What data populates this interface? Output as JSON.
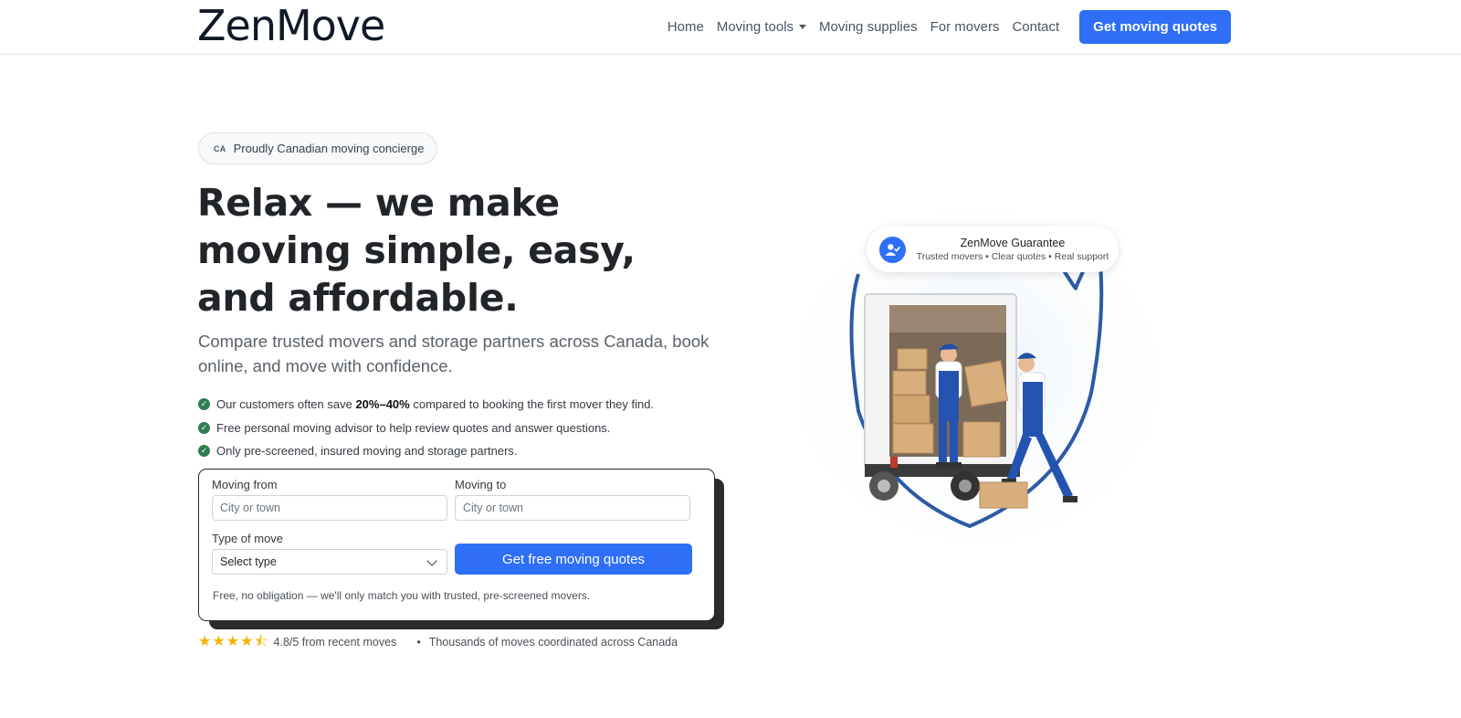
{
  "brand": {
    "name": "ZenMove"
  },
  "nav": {
    "items": [
      "Home",
      "Moving tools",
      "Moving supplies",
      "For movers",
      "Contact"
    ],
    "cta": "Get moving quotes"
  },
  "hero": {
    "badge_code": "CA",
    "badge_text": "Proudly Canadian moving concierge",
    "headline": "Relax — we make moving simple, easy, and affordable.",
    "lead": "Compare trusted movers and storage partners across Canada, book online, and move with confidence.",
    "benefits": {
      "b1_pre": "Our customers often save ",
      "b1_bold": "20%–40%",
      "b1_post": " compared to booking the first mover they find.",
      "b2": "Free personal moving advisor to help review quotes and answer questions.",
      "b3": "Only pre-screened, insured moving and storage partners."
    }
  },
  "form": {
    "from_label": "Moving from",
    "from_placeholder": "City or town",
    "to_label": "Moving to",
    "to_placeholder": "City or town",
    "type_label": "Type of move",
    "type_selected": "Select type",
    "submit": "Get free moving quotes",
    "note": "Free, no obligation — we'll only match you with trusted, pre-screened movers."
  },
  "rating": {
    "stars": 4.5,
    "text": "4.8/5 from recent moves",
    "separator": "•",
    "moves_text": "Thousands of moves coordinated across Canada"
  },
  "guarantee": {
    "title": "ZenMove Guarantee",
    "subtitle": "Trusted movers • Clear quotes • Real support"
  },
  "colors": {
    "primary": "#2f6ff7",
    "check_green": "#2e7d4f",
    "star": "#f5b301",
    "shield_blue": "#2c5aa6"
  },
  "icons": {
    "check": "check-circle-icon",
    "chevron": "chevron-down-icon",
    "star": "star-icon",
    "guarantee": "user-check-icon"
  }
}
